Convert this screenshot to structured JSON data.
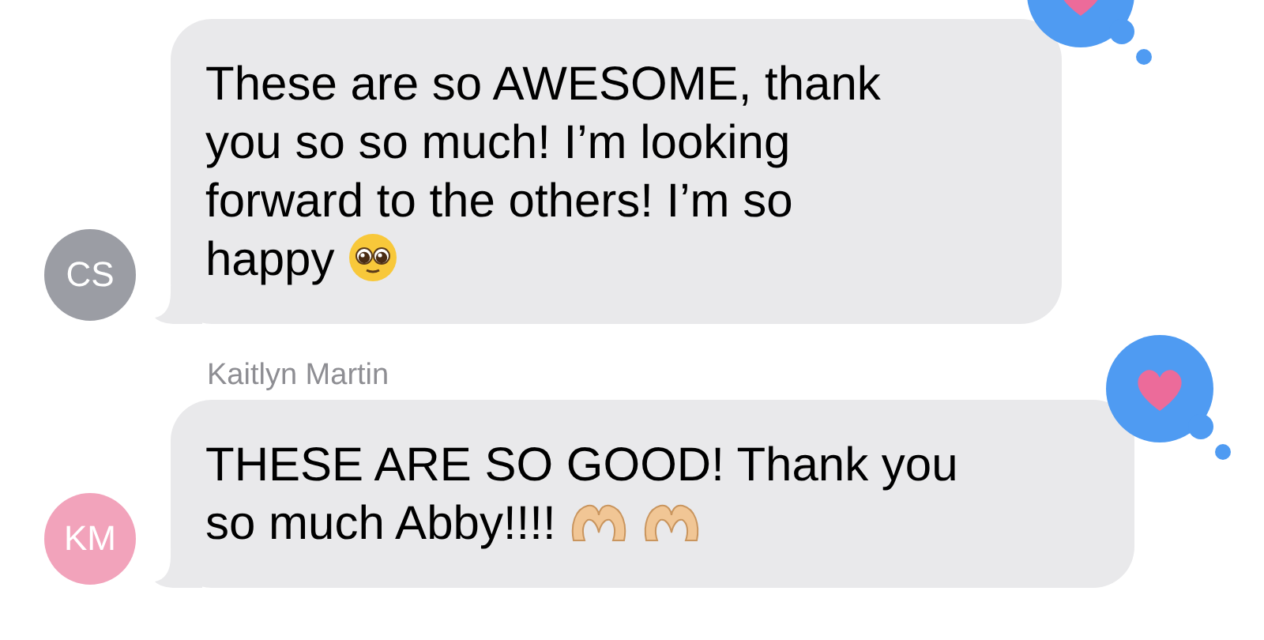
{
  "messages": [
    {
      "lines": [
        "These are so AWESOME, thank",
        "you so so much! I’m looking",
        "forward to the others! I’m so",
        "happy"
      ],
      "emoji": [
        {
          "kind": "pleading-face"
        }
      ],
      "initials": "CS",
      "color": "#9b9da4",
      "reaction": {
        "kind": "heart"
      }
    },
    {
      "sender": "Kaitlyn Martin",
      "lines": [
        "THESE ARE SO GOOD! Thank you",
        "so much Abby!!!!"
      ],
      "emoji": [
        {
          "kind": "heart-hands"
        },
        {
          "kind": "heart-hands"
        }
      ],
      "initials": "KM",
      "color": "#f2a3bb",
      "reaction": {
        "kind": "heart"
      }
    }
  ]
}
